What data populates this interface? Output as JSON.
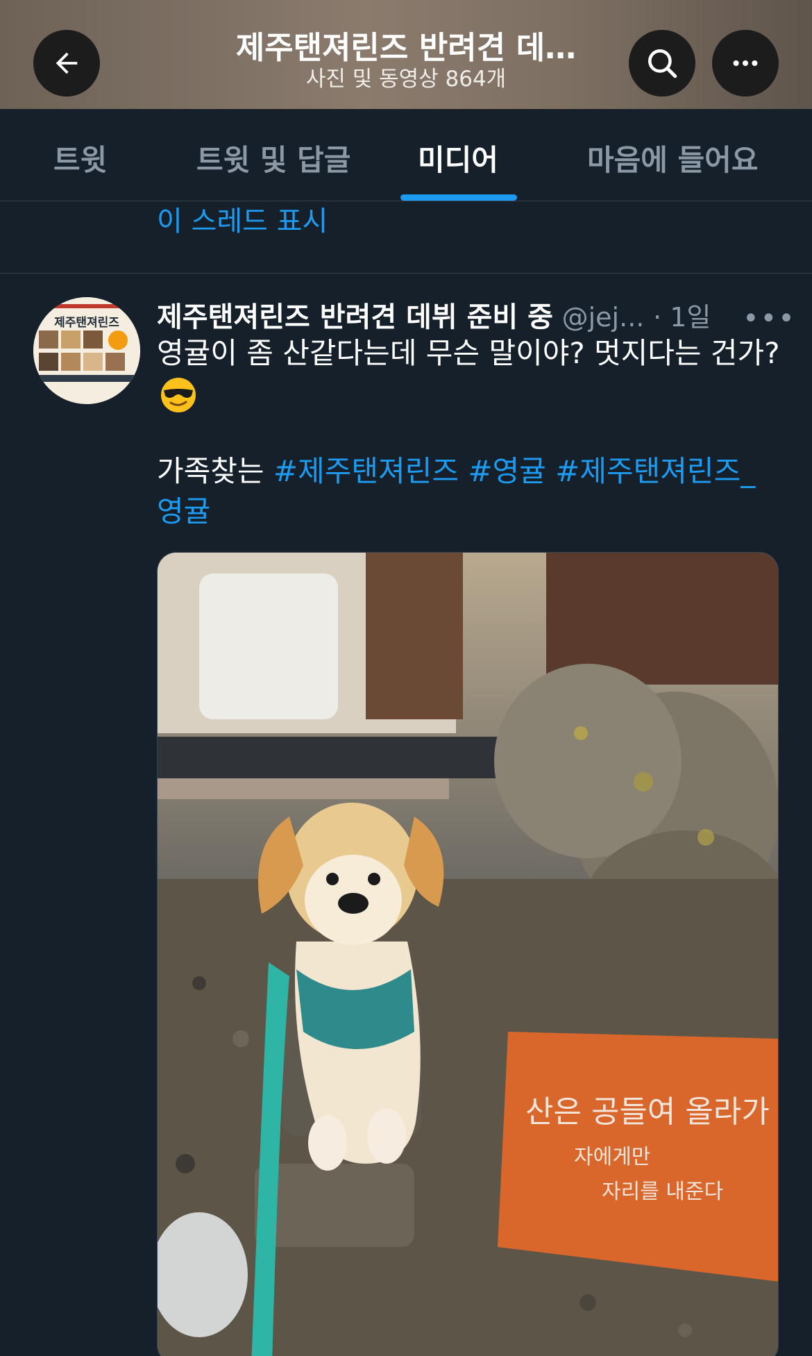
{
  "header": {
    "title": "제주탠져린즈 반려견 데…",
    "subtitle": "사진 및 동영상 864개",
    "icons": {
      "back": "arrow-left-icon",
      "search": "search-icon",
      "more": "more-horizontal-icon"
    }
  },
  "tabs": [
    {
      "label": "트윗",
      "active": false
    },
    {
      "label": "트윗 및 답글",
      "active": false
    },
    {
      "label": "미디어",
      "active": true
    },
    {
      "label": "마음에 들어요",
      "active": false
    }
  ],
  "thread": {
    "show_thread_label": "이 스레드 표시"
  },
  "tweet": {
    "author_name": "제주탠져린즈 반려견 데뷔 준비 중",
    "handle": "@jej...",
    "time": "· 1일",
    "more": "•••",
    "text_line1": "영귤이 좀 산같다는데 무슨 말이야? 멋지다는 건가?",
    "text_prefix": "가족찾는 ",
    "hashtags": [
      "#제주탠져린즈",
      "#영귤",
      "#제주탠져린즈_영귤"
    ],
    "avatar_text": "제주탠져린즈",
    "media_sign_text": [
      "산은 공들여 올라가",
      "자에게만",
      "자리를 내준다"
    ]
  },
  "colors": {
    "background": "#15202b",
    "accent": "#1d9bf0",
    "secondary_text": "#8b98a5",
    "divider": "#38444d"
  }
}
